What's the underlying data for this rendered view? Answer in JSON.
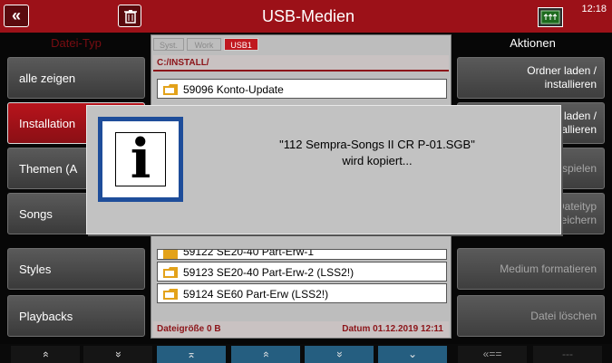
{
  "header": {
    "back_symbol": "«",
    "title": "USB-Medien",
    "time": "12:18",
    "left_label": "Datei-Typ",
    "right_label": "Aktionen"
  },
  "left_buttons": [
    {
      "label": "alle zeigen"
    },
    {
      "label": "Installation"
    },
    {
      "label": "Themen (A"
    },
    {
      "label": "Songs"
    },
    {
      "label": "Styles"
    },
    {
      "label": "Playbacks"
    }
  ],
  "right_buttons": [
    {
      "label": "Ordner laden  /\ninstallieren"
    },
    {
      "label": "laden  /\nnstallieren"
    },
    {
      "label": "kt  spielen"
    },
    {
      "label": "n  Dateityp\nspeichern"
    },
    {
      "label": "Medium  formatieren"
    },
    {
      "label": "Datei  löschen"
    }
  ],
  "tabs": [
    "Syst.",
    "Work",
    "USB1"
  ],
  "file_browser": {
    "path": "C:/INSTALL/",
    "items": [
      "59096 Konto-Update",
      "59122 SE20-40 Part-Erw-1",
      "59123 SE20-40 Part-Erw-2 (LSS2!)",
      "59124 SE60 Part-Erw (LSS2!)"
    ],
    "filesize": "Dateigröße 0 B",
    "date": "Datum 01.12.2019   12:11"
  },
  "dialog": {
    "line1": "\"112 Sempra-Songs II CR P-01.SGB\"",
    "line2": "wird kopiert...",
    "icon_letter": "i"
  },
  "bottom_buttons": [
    "«",
    "»",
    "⌅",
    "«",
    "»",
    "⌄",
    "«==",
    "---"
  ],
  "colors": {
    "accent": "#9c1118",
    "bottom_blue": "#255e80",
    "dialog_border": "#1e4d9a"
  }
}
